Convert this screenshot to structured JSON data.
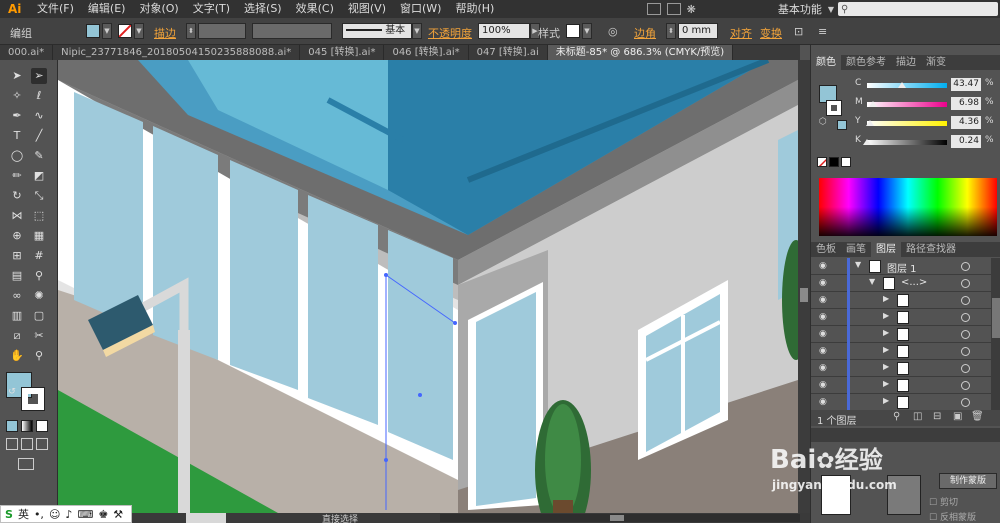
{
  "app": {
    "logo": "Ai"
  },
  "menu": [
    "文件(F)",
    "编辑(E)",
    "对象(O)",
    "文字(T)",
    "选择(S)",
    "效果(C)",
    "视图(V)",
    "窗口(W)",
    "帮助(H)"
  ],
  "workspace": {
    "label": "基本功能"
  },
  "control_bar": {
    "group_label": "编组",
    "stroke_label": "描边",
    "stroke_style": "基本",
    "opacity_label": "不透明度",
    "opacity_value": "100%",
    "style_label": "样式",
    "corner_label": "边角",
    "corner_value": "0 mm",
    "align_label": "对齐",
    "transform_label": "变换"
  },
  "tabs": [
    {
      "label": "000.ai*",
      "active": false
    },
    {
      "label": "Nipic_23771846_20180504150235888088.ai*",
      "active": false
    },
    {
      "label": "045 [转换].ai*",
      "active": false
    },
    {
      "label": "046 [转换].ai*",
      "active": false
    },
    {
      "label": "047 [转换].ai",
      "active": false
    },
    {
      "label": "未标题-85* @ 686.3% (CMYK/预览)",
      "active": true
    }
  ],
  "color_panel": {
    "tabs": [
      "颜色",
      "颜色参考",
      "描边",
      "渐变"
    ],
    "channels": [
      {
        "label": "C",
        "value": "43.47",
        "unit": "%"
      },
      {
        "label": "M",
        "value": "6.98",
        "unit": "%"
      },
      {
        "label": "Y",
        "value": "4.36",
        "unit": "%"
      },
      {
        "label": "K",
        "value": "0.24",
        "unit": "%"
      }
    ],
    "fill_color": "#93c5d6"
  },
  "layers_panel": {
    "tabs": [
      "色板",
      "画笔",
      "图层",
      "路径查找器"
    ],
    "rows": [
      {
        "label": "图层 1",
        "indent": 0,
        "expanded": true
      },
      {
        "label": "<...>",
        "indent": 1,
        "expanded": true
      },
      {
        "label": "",
        "indent": 2,
        "expanded": false
      },
      {
        "label": "",
        "indent": 2,
        "expanded": false
      },
      {
        "label": "",
        "indent": 2,
        "expanded": false
      },
      {
        "label": "",
        "indent": 2,
        "expanded": false
      },
      {
        "label": "",
        "indent": 2,
        "expanded": false
      },
      {
        "label": "",
        "indent": 2,
        "expanded": false
      },
      {
        "label": "",
        "indent": 2,
        "expanded": false
      }
    ],
    "footer_count": "1 个图层"
  },
  "transparency_panel": {
    "make_mask": "制作蒙版",
    "clip": "剪切",
    "invert_mask": "反相蒙版"
  },
  "status_bar": {
    "tool": "直接选择"
  },
  "ime": {
    "lang": "英"
  },
  "watermark": {
    "brand": "Bai",
    "cn": "经验",
    "url": "jingyan.baidu.com"
  }
}
